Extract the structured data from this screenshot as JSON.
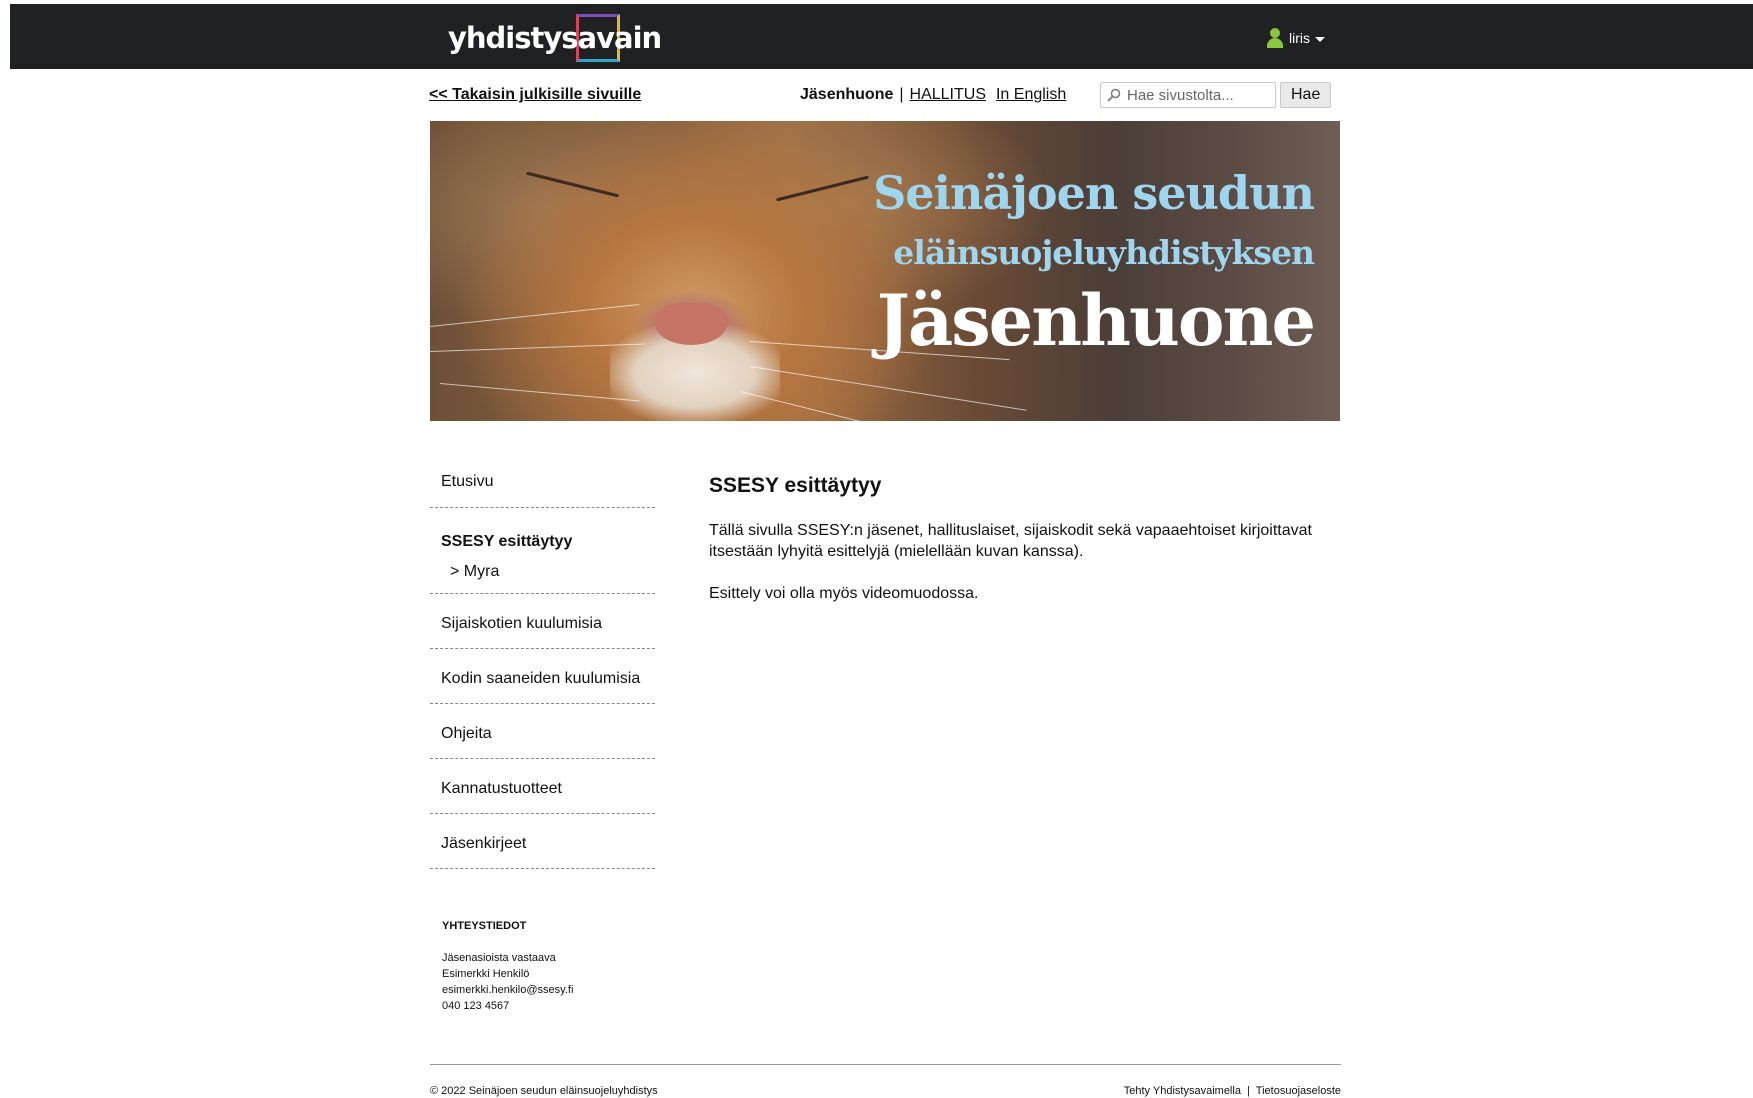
{
  "header": {
    "logo_text": "yhdistysavain",
    "user_name": "liris"
  },
  "subnav": {
    "back_link": "<< Takaisin julkisille sivuille",
    "current": "Jäsenhuone",
    "separator": "|",
    "links": [
      "HALLITUS",
      "In English"
    ],
    "search_placeholder": "Hae sivustolta...",
    "search_button": "Hae"
  },
  "banner": {
    "line1": "Seinäjoen seudun",
    "line2": "eläinsuojeluyhdistyksen",
    "line3": "Jäsenhuone",
    "colors": {
      "light_blue": "#9fd6ef",
      "white": "#ffffff"
    }
  },
  "sidebar": {
    "items_before": [
      "Etusivu"
    ],
    "active": "SSESY esittäytyy",
    "sub": "> Myra",
    "items_after": [
      "Sijaiskotien kuulumisia",
      "Kodin saaneiden kuulumisia",
      "Ohjeita",
      "Kannatustuotteet",
      "Jäsenkirjeet"
    ]
  },
  "contact": {
    "heading": "YHTEYSTIEDOT",
    "lines": [
      "Jäsenasioista vastaava",
      "Esimerkki Henkilö",
      "esimerkki.henkilo@ssesy.fi",
      "040 123 4567"
    ]
  },
  "main": {
    "title": "SSESY esittäytyy",
    "paragraphs": [
      "Tällä sivulla SSESY:n jäsenet, hallituslaiset, sijaiskodit sekä vapaaehtoiset kirjoittavat itsestään lyhyitä esittelyjä (mielellään kuvan kanssa).",
      "Esittely voi olla myös videomuodossa."
    ]
  },
  "footer": {
    "copyright": "© 2022 Seinäjoen seudun eläinsuojeluyhdistys",
    "made_with": "Tehty Yhdistysavaimella",
    "separator": "|",
    "privacy": "Tietosuojaseloste"
  }
}
